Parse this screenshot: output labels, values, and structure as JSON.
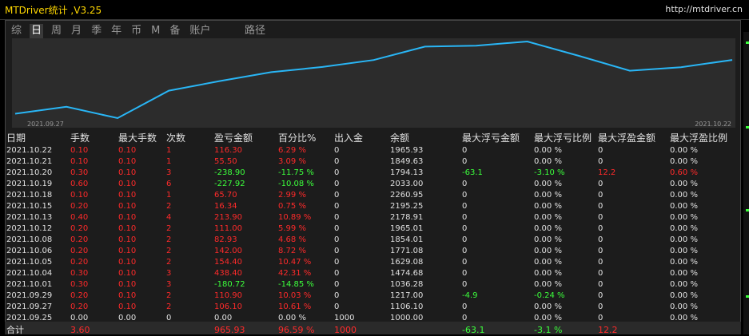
{
  "app": {
    "title": "MTDriver统计 ,V3.25",
    "url": "http://mtdriver.cn"
  },
  "tabs": [
    "综",
    "日",
    "周",
    "月",
    "季",
    "年",
    "币",
    "M",
    "备",
    "账户"
  ],
  "active_tab": 1,
  "path_tab": "路径",
  "chart_data": {
    "type": "line",
    "x": [
      "2021.09.27",
      "2021.09.29",
      "2021.10.01",
      "2021.10.04",
      "2021.10.05",
      "2021.10.06",
      "2021.10.08",
      "2021.10.12",
      "2021.10.13",
      "2021.10.15",
      "2021.10.18",
      "2021.10.19",
      "2021.10.20",
      "2021.10.21",
      "2021.10.22"
    ],
    "y": [
      1106.1,
      1217.0,
      1036.28,
      1474.68,
      1629.08,
      1771.08,
      1854.01,
      1965.01,
      2178.91,
      2195.25,
      2260.95,
      2033.0,
      1794.13,
      1849.63,
      1965.93
    ],
    "x_start_label": "2021.09.27",
    "x_end_label": "2021.10.22",
    "color": "#29b6f6"
  },
  "table": {
    "headers": [
      "日期",
      "手数",
      "最大手数",
      "次数",
      "盈亏金额",
      "百分比%",
      "出入金",
      "余额",
      "最大浮亏金额",
      "最大浮亏比例",
      "最大浮盈金额",
      "最大浮盈比例"
    ],
    "rows": [
      [
        "2021.10.22",
        "0.10",
        "0.10",
        "1",
        "116.30",
        "6.29 %",
        "0",
        "1965.93",
        "0",
        "0.00 %",
        "0",
        "0.00 %"
      ],
      [
        "2021.10.21",
        "0.10",
        "0.10",
        "1",
        "55.50",
        "3.09 %",
        "0",
        "1849.63",
        "0",
        "0.00 %",
        "0",
        "0.00 %"
      ],
      [
        "2021.10.20",
        "0.30",
        "0.10",
        "3",
        "-238.90",
        "-11.75 %",
        "0",
        "1794.13",
        "-63.1",
        "-3.10 %",
        "12.2",
        "0.60 %"
      ],
      [
        "2021.10.19",
        "0.60",
        "0.10",
        "6",
        "-227.92",
        "-10.08 %",
        "0",
        "2033.00",
        "0",
        "0.00 %",
        "0",
        "0.00 %"
      ],
      [
        "2021.10.18",
        "0.10",
        "0.10",
        "1",
        "65.70",
        "2.99 %",
        "0",
        "2260.95",
        "0",
        "0.00 %",
        "0",
        "0.00 %"
      ],
      [
        "2021.10.15",
        "0.20",
        "0.10",
        "2",
        "16.34",
        "0.75 %",
        "0",
        "2195.25",
        "0",
        "0.00 %",
        "0",
        "0.00 %"
      ],
      [
        "2021.10.13",
        "0.40",
        "0.10",
        "4",
        "213.90",
        "10.89 %",
        "0",
        "2178.91",
        "0",
        "0.00 %",
        "0",
        "0.00 %"
      ],
      [
        "2021.10.12",
        "0.20",
        "0.10",
        "2",
        "111.00",
        "5.99 %",
        "0",
        "1965.01",
        "0",
        "0.00 %",
        "0",
        "0.00 %"
      ],
      [
        "2021.10.08",
        "0.20",
        "0.10",
        "2",
        "82.93",
        "4.68 %",
        "0",
        "1854.01",
        "0",
        "0.00 %",
        "0",
        "0.00 %"
      ],
      [
        "2021.10.06",
        "0.20",
        "0.10",
        "2",
        "142.00",
        "8.72 %",
        "0",
        "1771.08",
        "0",
        "0.00 %",
        "0",
        "0.00 %"
      ],
      [
        "2021.10.05",
        "0.20",
        "0.10",
        "2",
        "154.40",
        "10.47 %",
        "0",
        "1629.08",
        "0",
        "0.00 %",
        "0",
        "0.00 %"
      ],
      [
        "2021.10.04",
        "0.30",
        "0.10",
        "3",
        "438.40",
        "42.31 %",
        "0",
        "1474.68",
        "0",
        "0.00 %",
        "0",
        "0.00 %"
      ],
      [
        "2021.10.01",
        "0.30",
        "0.10",
        "3",
        "-180.72",
        "-14.85 %",
        "0",
        "1036.28",
        "0",
        "0.00 %",
        "0",
        "0.00 %"
      ],
      [
        "2021.09.29",
        "0.20",
        "0.10",
        "2",
        "110.90",
        "10.03 %",
        "0",
        "1217.00",
        "-4.9",
        "-0.24 %",
        "0",
        "0.00 %"
      ],
      [
        "2021.09.27",
        "0.20",
        "0.10",
        "2",
        "106.10",
        "10.61 %",
        "0",
        "1106.10",
        "0",
        "0.00 %",
        "0",
        "0.00 %"
      ],
      [
        "2021.09.25",
        "0.00",
        "0.00",
        "0",
        "0.00",
        "0.00 %",
        "1000",
        "1000.00",
        "0",
        "0.00 %",
        "0",
        "0.00 %"
      ]
    ],
    "total": [
      "合计",
      "3.60",
      "",
      "",
      "965.93",
      "96.59 %",
      "1000",
      "",
      "-63.1",
      "-3.1 %",
      "12.2",
      ""
    ]
  },
  "colors": {
    "profit": "#ff2a2a",
    "loss": "#3cff3c",
    "neutral": "#e0e0e0",
    "line": "#29b6f6"
  }
}
